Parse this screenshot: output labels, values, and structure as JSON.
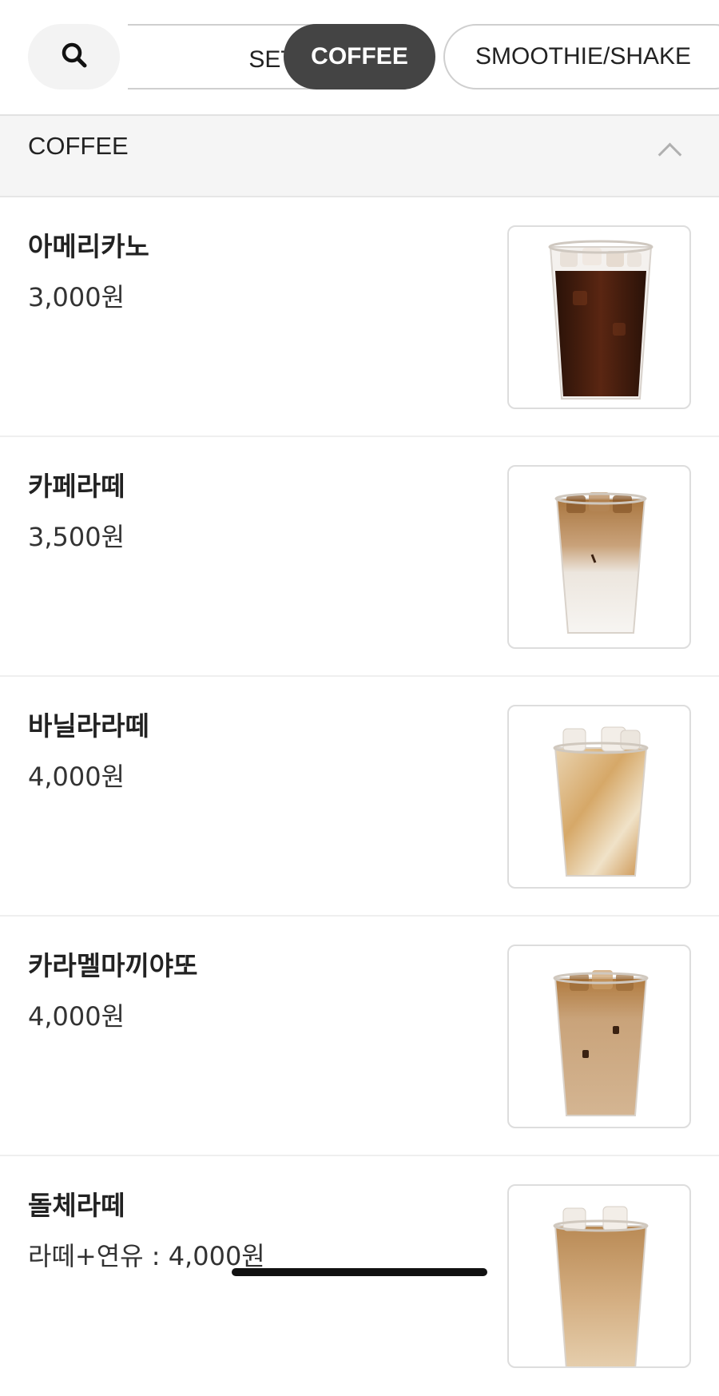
{
  "search": {
    "icon": "search-icon"
  },
  "categories": [
    {
      "label": "SET 메뉴 …",
      "active": false
    },
    {
      "label": "COFFEE",
      "active": true
    },
    {
      "label": "SMOOTHIE/SHAKE",
      "active": false
    }
  ],
  "section": {
    "title": "COFFEE",
    "toggle_icon": "chevron-up-icon"
  },
  "items": [
    {
      "name": "아메리카노",
      "price": "3,000원",
      "drink": "americano"
    },
    {
      "name": "카페라떼",
      "price": "3,500원",
      "drink": "latte"
    },
    {
      "name": "바닐라라떼",
      "price": "4,000원",
      "drink": "vanilla-latte"
    },
    {
      "name": "카라멜마끼야또",
      "price": "4,000원",
      "drink": "caramel-macchiato"
    },
    {
      "name": "돌체라떼",
      "price": "라떼+연유 : 4,000원",
      "drink": "dolce-latte"
    }
  ],
  "colors": {
    "active_chip": "#444444",
    "section_bg": "#f5f5f5",
    "border": "#cfcfcf"
  }
}
